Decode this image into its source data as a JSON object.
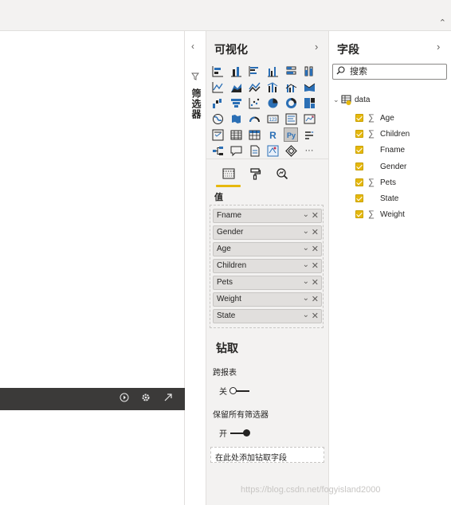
{
  "filters_pane": {
    "title": "筛选器",
    "collapse_icon": "chevron-left-icon",
    "filter_icon": "funnel-icon"
  },
  "visualizations_pane": {
    "title": "可视化",
    "collapse_icon": "chevron-right-icon",
    "python_visual_label": "Py",
    "r_visual_label": "R",
    "more_label": "···",
    "tabs": [
      "fields-tab",
      "format-tab",
      "analytics-tab"
    ],
    "values_section_label": "值",
    "value_wells": [
      {
        "label": "Fname"
      },
      {
        "label": "Gender"
      },
      {
        "label": "Age"
      },
      {
        "label": "Children"
      },
      {
        "label": "Pets"
      },
      {
        "label": "Weight"
      },
      {
        "label": "State"
      }
    ],
    "drillthrough": {
      "title": "钻取",
      "cross_report_label": "跨报表",
      "cross_report_toggle": "关",
      "keep_filters_label": "保留所有筛选器",
      "keep_filters_toggle": "开",
      "drop_placeholder": "在此处添加钻取字段"
    }
  },
  "fields_pane": {
    "title": "字段",
    "collapse_icon": "chevron-right-icon",
    "search_placeholder": "搜索",
    "table_name": "data",
    "fields": [
      {
        "label": "Age",
        "sigma": true
      },
      {
        "label": "Children",
        "sigma": true
      },
      {
        "label": "Fname",
        "sigma": false
      },
      {
        "label": "Gender",
        "sigma": false
      },
      {
        "label": "Pets",
        "sigma": true
      },
      {
        "label": "State",
        "sigma": false
      },
      {
        "label": "Weight",
        "sigma": true
      }
    ]
  },
  "visual_header_icons": [
    "play-icon",
    "gear-icon",
    "expand-icon",
    "chevron-down-icon"
  ],
  "watermark": "https://blog.csdn.net/fogyisland2000",
  "colors": {
    "accent": "#e6b80d",
    "pane_bg": "#f3f2f1",
    "dark_bar": "#3b3a39",
    "icon_blue": "#2b6fb5"
  }
}
